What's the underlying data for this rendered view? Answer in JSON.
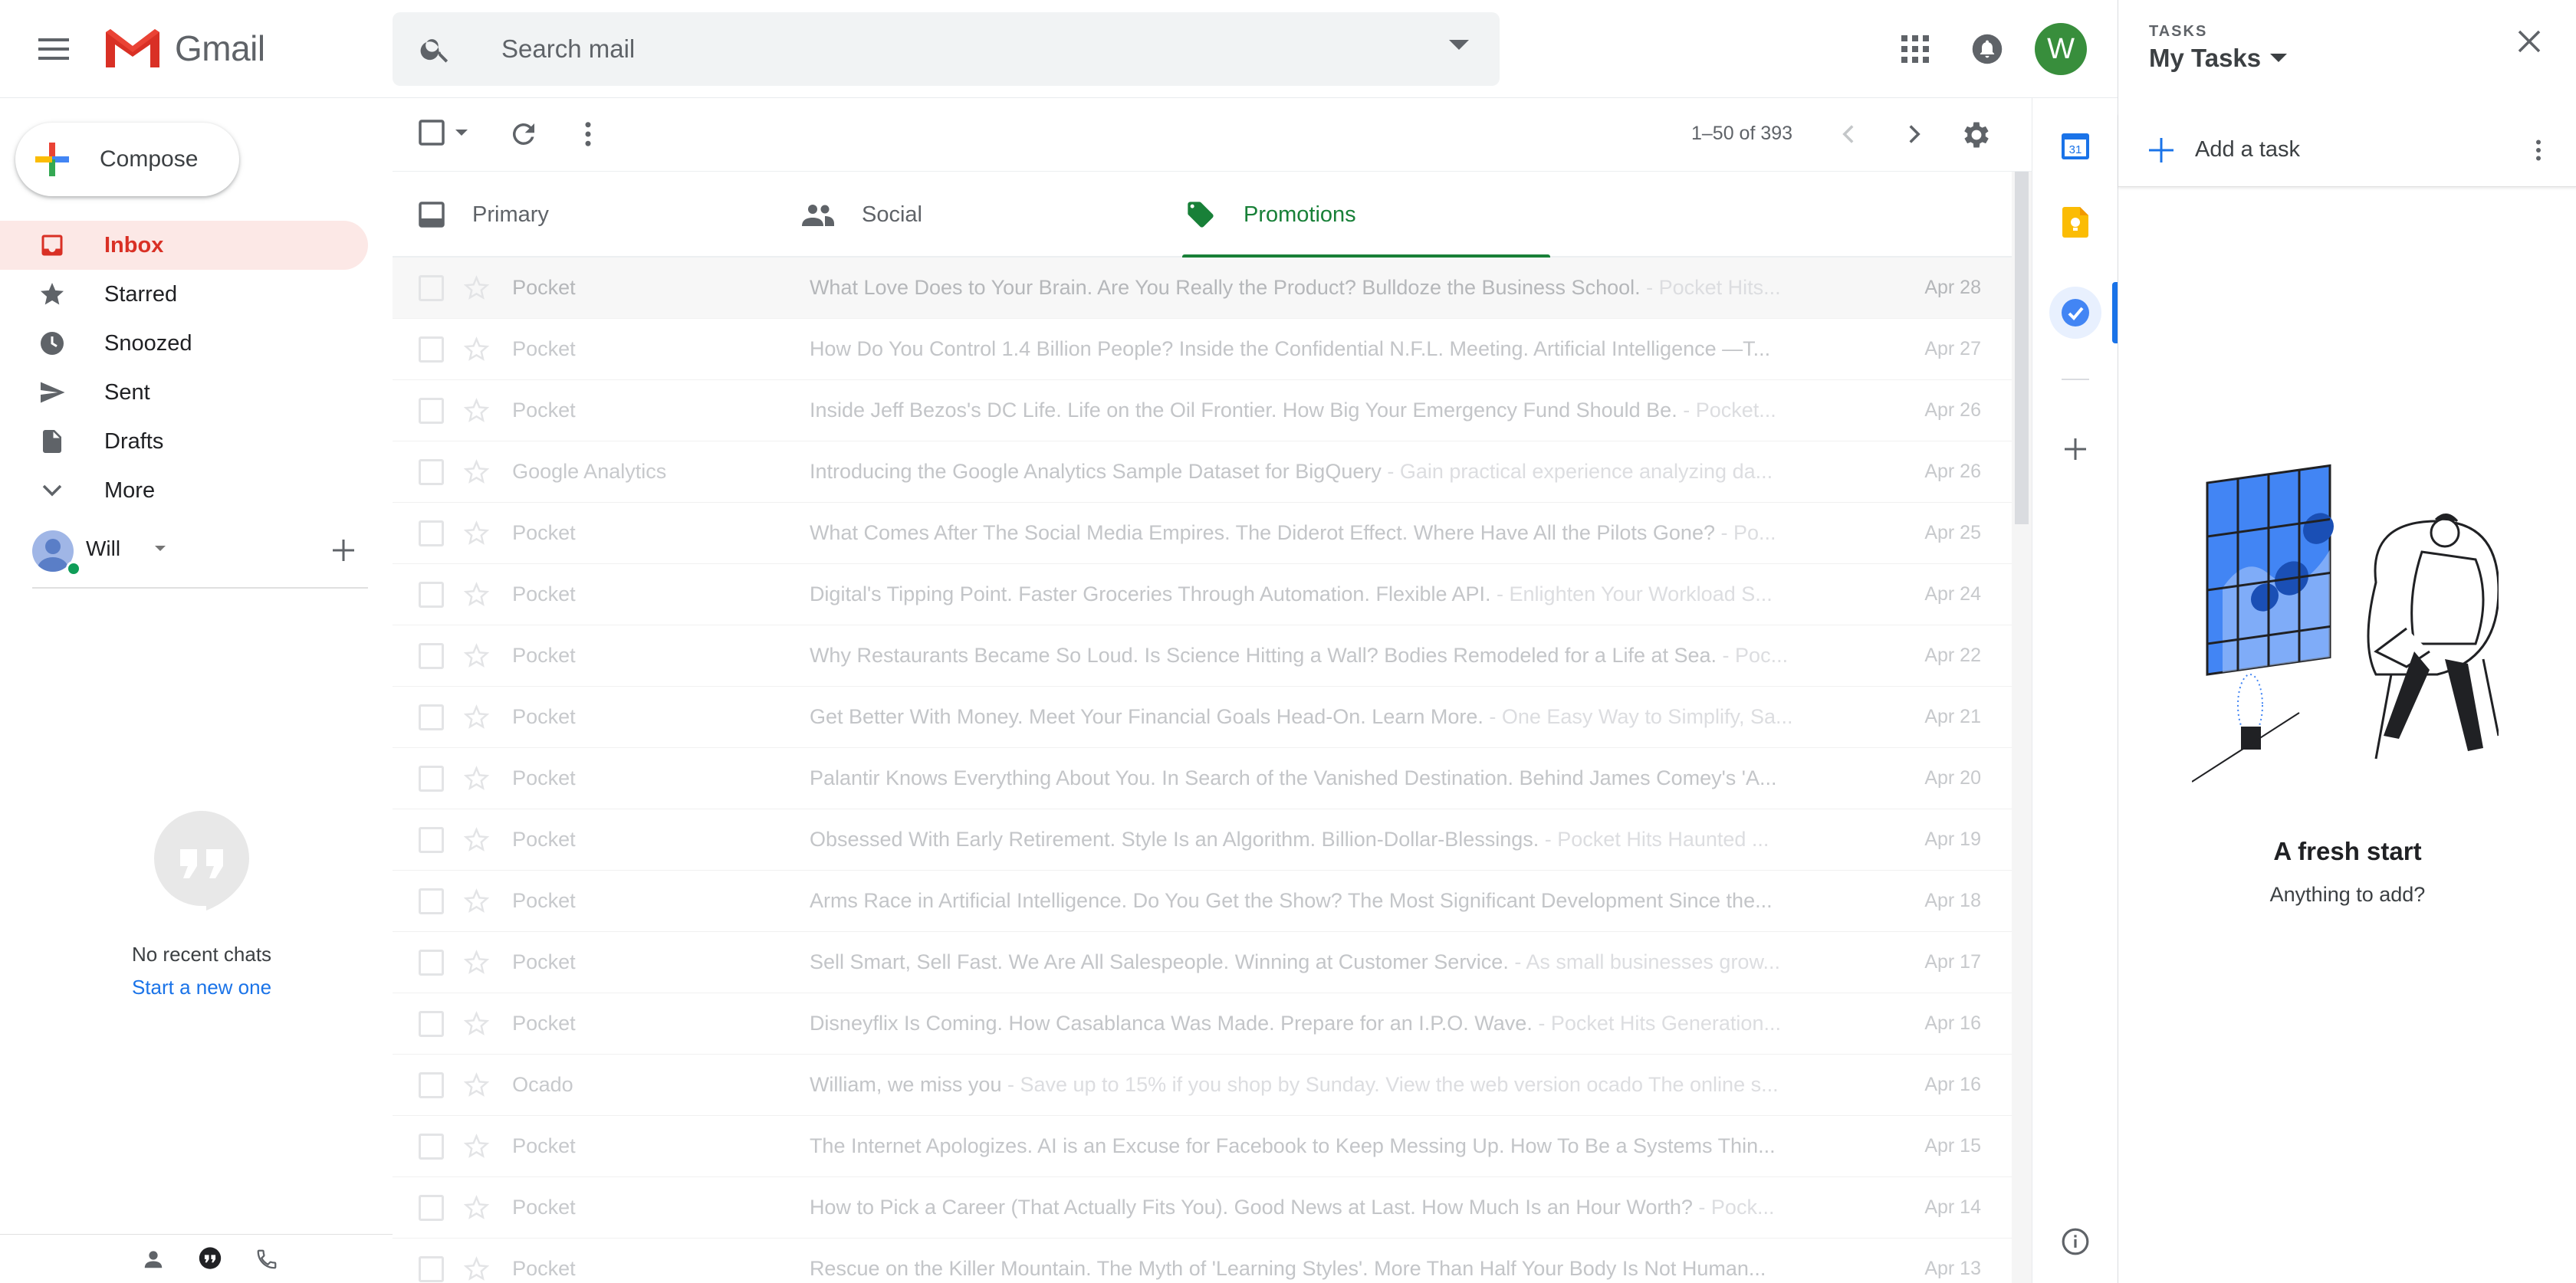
{
  "app": {
    "name": "Gmail",
    "search_placeholder": "Search mail",
    "account_initial": "W",
    "accent": "#d93025",
    "promotions_color": "#188038"
  },
  "compose": {
    "label": "Compose"
  },
  "nav": {
    "items": [
      {
        "label": "Inbox",
        "icon": "inbox-icon",
        "active": true
      },
      {
        "label": "Starred",
        "icon": "star-icon"
      },
      {
        "label": "Snoozed",
        "icon": "clock-icon"
      },
      {
        "label": "Sent",
        "icon": "send-icon"
      },
      {
        "label": "Drafts",
        "icon": "draft-icon"
      },
      {
        "label": "More",
        "icon": "chevron-down-icon"
      }
    ]
  },
  "hangouts": {
    "user_name": "Will",
    "no_chats": "No recent chats",
    "start_new": "Start a new one"
  },
  "toolbar": {
    "count": "1–50 of 393"
  },
  "tabs": [
    {
      "label": "Primary",
      "icon": "inbox-tab-icon"
    },
    {
      "label": "Social",
      "icon": "people-icon"
    },
    {
      "label": "Promotions",
      "icon": "tag-icon",
      "active": true
    }
  ],
  "emails": [
    {
      "sender": "Pocket",
      "subject": "What Love Does to Your Brain. Are You Really the Product? Bulldoze the Business School.",
      "preview": " - Pocket Hits...",
      "date": "Apr 28"
    },
    {
      "sender": "Pocket",
      "subject": "How Do You Control 1.4 Billion People? Inside the Confidential N.F.L. Meeting. Artificial Intelligence —T...",
      "preview": "",
      "date": "Apr 27"
    },
    {
      "sender": "Pocket",
      "subject": "Inside Jeff Bezos's DC Life. Life on the Oil Frontier. How Big Your Emergency Fund Should Be.",
      "preview": " - Pocket...",
      "date": "Apr 26"
    },
    {
      "sender": "Google Analytics",
      "subject": "Introducing the Google Analytics Sample Dataset for BigQuery",
      "preview": " - Gain practical experience analyzing da...",
      "date": "Apr 26"
    },
    {
      "sender": "Pocket",
      "subject": "What Comes After The Social Media Empires. The Diderot Effect. Where Have All the Pilots Gone?",
      "preview": " - Po...",
      "date": "Apr 25"
    },
    {
      "sender": "Pocket",
      "subject": "Digital's Tipping Point. Faster Groceries Through Automation. Flexible API.",
      "preview": " - Enlighten Your Workload S...",
      "date": "Apr 24"
    },
    {
      "sender": "Pocket",
      "subject": "Why Restaurants Became So Loud. Is Science Hitting a Wall? Bodies Remodeled for a Life at Sea.",
      "preview": " - Poc...",
      "date": "Apr 22"
    },
    {
      "sender": "Pocket",
      "subject": "Get Better With Money. Meet Your Financial Goals Head-On. Learn More.",
      "preview": " - One Easy Way to Simplify, Sa...",
      "date": "Apr 21"
    },
    {
      "sender": "Pocket",
      "subject": "Palantir Knows Everything About You. In Search of the Vanished Destination. Behind James Comey's 'A...",
      "preview": "",
      "date": "Apr 20"
    },
    {
      "sender": "Pocket",
      "subject": "Obsessed With Early Retirement. Style Is an Algorithm. Billion-Dollar-Blessings.",
      "preview": " - Pocket Hits Haunted ...",
      "date": "Apr 19"
    },
    {
      "sender": "Pocket",
      "subject": "Arms Race in Artificial Intelligence. Do You Get the Show? The Most Significant Development Since the...",
      "preview": "",
      "date": "Apr 18"
    },
    {
      "sender": "Pocket",
      "subject": "Sell Smart, Sell Fast. We Are All Salespeople. Winning at Customer Service.",
      "preview": " - As small businesses grow...",
      "date": "Apr 17"
    },
    {
      "sender": "Pocket",
      "subject": "Disneyflix Is Coming. How Casablanca Was Made. Prepare for an I.P.O. Wave.",
      "preview": " - Pocket Hits Generation...",
      "date": "Apr 16"
    },
    {
      "sender": "Ocado",
      "subject": "William, we miss you",
      "preview": " - Save up to 15% if you shop by Sunday. View the web version ocado The online s...",
      "date": "Apr 16"
    },
    {
      "sender": "Pocket",
      "subject": "The Internet Apologizes. AI is an Excuse for Facebook to Keep Messing Up. How To Be a Systems Thin...",
      "preview": "",
      "date": "Apr 15"
    },
    {
      "sender": "Pocket",
      "subject": "How to Pick a Career (That Actually Fits You). Good News at Last. How Much Is an Hour Worth?",
      "preview": " - Pock...",
      "date": "Apr 14"
    },
    {
      "sender": "Pocket",
      "subject": "Rescue on the Killer Mountain. The Myth of 'Learning Styles'. More Than Half Your Body Is Not Human...",
      "preview": "",
      "date": "Apr 13"
    }
  ],
  "tasks": {
    "kicker": "TASKS",
    "title": "My Tasks",
    "add_label": "Add a task",
    "empty_title": "A fresh start",
    "empty_sub": "Anything to add?"
  }
}
